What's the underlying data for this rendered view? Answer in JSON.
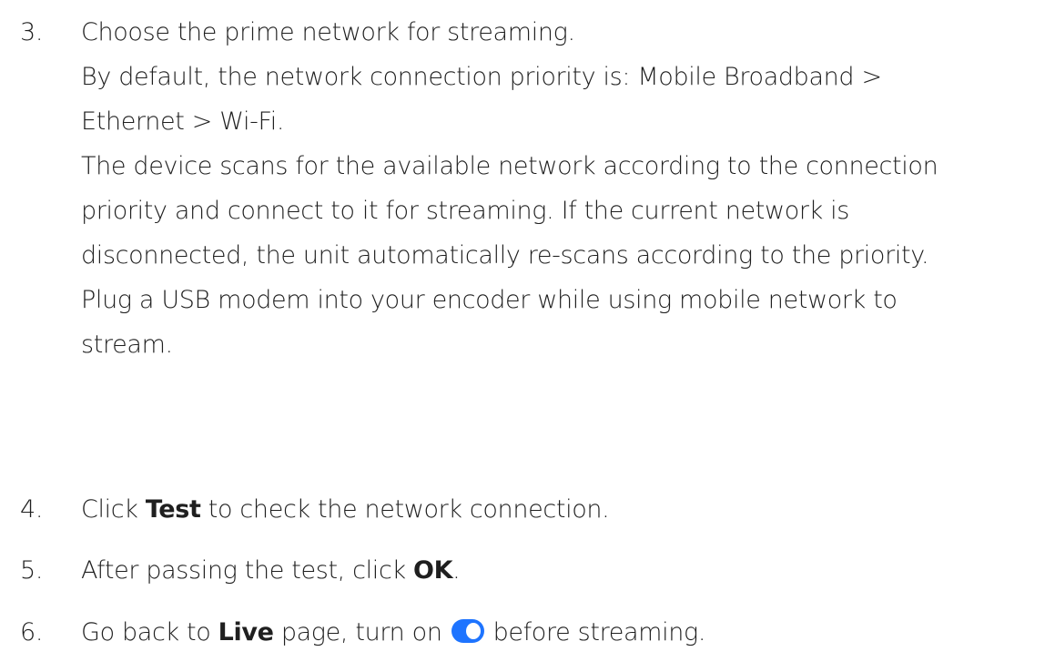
{
  "steps": [
    {
      "number": "3.",
      "lines": [
        "Choose the prime network for streaming.",
        "By default, the network connection priority is: Mobile Broadband >",
        "Ethernet > Wi-Fi.",
        "The device scans for the available network according to the connection",
        "priority and connect to it for streaming. If the current network is",
        "disconnected, the unit automatically re-scans according to the priority.",
        "Plug a USB modem into your encoder while using mobile network to",
        "stream."
      ]
    },
    {
      "number": "4.",
      "before": "Click ",
      "bold": "Test",
      "after": " to check the network connection."
    },
    {
      "number": "5.",
      "before": "After passing the test, click ",
      "bold": "OK",
      "after": "."
    },
    {
      "number": "6.",
      "before": "Go back to ",
      "bold": "Live",
      "middle": " page, turn on",
      "after": "before streaming.",
      "toggle_icon": "toggle-switch-on-icon",
      "toggle_color": "#1e74ff"
    }
  ]
}
